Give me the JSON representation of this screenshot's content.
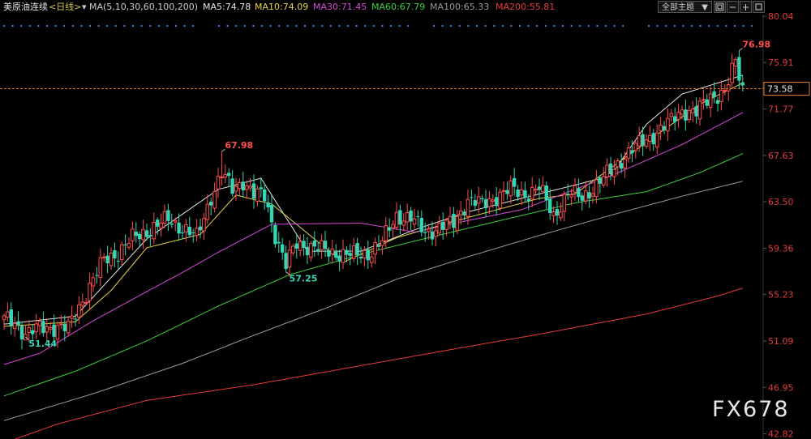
{
  "header": {
    "instrument": "美原油连续",
    "period": "<日线>",
    "ma_params": "MA(5,10,30,60,100,200)",
    "ma_values": [
      {
        "label": "MA5:74.78",
        "color": "#e6e6e6"
      },
      {
        "label": "MA10:74.09",
        "color": "#e8d44d"
      },
      {
        "label": "MA30:71.45",
        "color": "#d84ad8"
      },
      {
        "label": "MA60:67.79",
        "color": "#3ccf3c"
      },
      {
        "label": "MA100:65.33",
        "color": "#9a9a9a"
      },
      {
        "label": "MA200:55.81",
        "color": "#e83a3a"
      }
    ],
    "theme_select": "全部主题"
  },
  "colors": {
    "up": "#ff4d4d",
    "down": "#33d6b4",
    "axis_text": "#e03c3c",
    "last_price_line": "#e07b2b",
    "dots": "#2f7fff"
  },
  "watermark": "FX678",
  "chart_data": {
    "type": "candlestick",
    "y_range": [
      42.0,
      80.04
    ],
    "y_ticks": [
      "80.04",
      "75.91",
      "71.77",
      "67.63",
      "63.50",
      "59.36",
      "55.23",
      "51.09",
      "46.95",
      "42.82"
    ],
    "last_price": "73.58",
    "annotations": [
      {
        "label": "51.44",
        "value": 51.44,
        "index": 6,
        "kind": "low"
      },
      {
        "label": "67.98",
        "value": 67.98,
        "index": 61,
        "kind": "high"
      },
      {
        "label": "57.25",
        "value": 57.25,
        "index": 79,
        "kind": "low"
      },
      {
        "label": "76.98",
        "value": 76.98,
        "index": 206,
        "kind": "high"
      }
    ],
    "moving_averages": [
      {
        "name": "MA5",
        "color": "#e6e6e6",
        "values": [
          [
            0,
            52.6
          ],
          [
            20,
            53.3
          ],
          [
            40,
            60.2
          ],
          [
            60,
            64.6
          ],
          [
            72,
            65.6
          ],
          [
            85,
            59.1
          ],
          [
            100,
            59.1
          ],
          [
            115,
            61.0
          ],
          [
            130,
            62.6
          ],
          [
            150,
            64.2
          ],
          [
            170,
            65.8
          ],
          [
            180,
            70.4
          ],
          [
            190,
            73.1
          ],
          [
            207,
            74.78
          ]
        ]
      },
      {
        "name": "MA10",
        "color": "#e8d44d",
        "values": [
          [
            0,
            52.4
          ],
          [
            20,
            52.8
          ],
          [
            30,
            55.6
          ],
          [
            40,
            59.4
          ],
          [
            55,
            60.6
          ],
          [
            65,
            64.1
          ],
          [
            75,
            63.3
          ],
          [
            95,
            58.1
          ],
          [
            110,
            60.3
          ],
          [
            130,
            62.1
          ],
          [
            150,
            63.8
          ],
          [
            160,
            64.2
          ],
          [
            180,
            68.8
          ],
          [
            195,
            72.2
          ],
          [
            207,
            74.09
          ]
        ]
      },
      {
        "name": "MA30",
        "color": "#d84ad8",
        "values": [
          [
            0,
            49.0
          ],
          [
            10,
            50.0
          ],
          [
            25,
            52.9
          ],
          [
            40,
            55.5
          ],
          [
            50,
            57.2
          ],
          [
            60,
            59.0
          ],
          [
            75,
            61.5
          ],
          [
            100,
            61.6
          ],
          [
            115,
            60.8
          ],
          [
            125,
            61.5
          ],
          [
            145,
            62.8
          ],
          [
            170,
            65.8
          ],
          [
            190,
            68.6
          ],
          [
            207,
            71.45
          ]
        ]
      },
      {
        "name": "MA60",
        "color": "#3ccf3c",
        "values": [
          [
            0,
            46.2
          ],
          [
            20,
            48.4
          ],
          [
            40,
            51.1
          ],
          [
            60,
            54.2
          ],
          [
            80,
            57.0
          ],
          [
            100,
            58.8
          ],
          [
            115,
            60.0
          ],
          [
            140,
            61.9
          ],
          [
            160,
            63.4
          ],
          [
            180,
            64.4
          ],
          [
            195,
            66.1
          ],
          [
            207,
            67.79
          ]
        ]
      },
      {
        "name": "MA100",
        "color": "#9a9a9a",
        "values": [
          [
            0,
            44.0
          ],
          [
            25,
            46.4
          ],
          [
            50,
            49.1
          ],
          [
            70,
            51.6
          ],
          [
            90,
            54.0
          ],
          [
            110,
            56.6
          ],
          [
            130,
            58.6
          ],
          [
            150,
            60.5
          ],
          [
            170,
            62.3
          ],
          [
            190,
            64.0
          ],
          [
            207,
            65.33
          ]
        ]
      },
      {
        "name": "MA200",
        "color": "#e83a3a",
        "values": [
          [
            0,
            42.0
          ],
          [
            15,
            43.7
          ],
          [
            40,
            45.8
          ],
          [
            70,
            47.2
          ],
          [
            100,
            48.9
          ],
          [
            130,
            50.6
          ],
          [
            150,
            51.7
          ],
          [
            180,
            53.5
          ],
          [
            200,
            55.1
          ],
          [
            207,
            55.81
          ]
        ]
      }
    ],
    "price_path": [
      [
        0,
        53.0
      ],
      [
        3,
        52.7
      ],
      [
        6,
        51.8
      ],
      [
        10,
        52.2
      ],
      [
        15,
        52.4
      ],
      [
        18,
        52.2
      ],
      [
        20,
        53.5
      ],
      [
        24,
        56.0
      ],
      [
        28,
        58.3
      ],
      [
        32,
        59.0
      ],
      [
        36,
        60.2
      ],
      [
        40,
        60.9
      ],
      [
        43,
        61.4
      ],
      [
        46,
        61.9
      ],
      [
        50,
        61.2
      ],
      [
        54,
        60.3
      ],
      [
        58,
        64.0
      ],
      [
        61,
        66.0
      ],
      [
        64,
        64.6
      ],
      [
        67,
        65.4
      ],
      [
        70,
        64.1
      ],
      [
        73,
        64.0
      ],
      [
        76,
        60.6
      ],
      [
        79,
        57.8
      ],
      [
        82,
        59.8
      ],
      [
        86,
        59.5
      ],
      [
        90,
        59.1
      ],
      [
        94,
        58.9
      ],
      [
        98,
        58.7
      ],
      [
        102,
        58.9
      ],
      [
        106,
        59.9
      ],
      [
        110,
        62.3
      ],
      [
        114,
        62.0
      ],
      [
        118,
        60.8
      ],
      [
        122,
        61.2
      ],
      [
        126,
        61.6
      ],
      [
        130,
        63.7
      ],
      [
        134,
        63.2
      ],
      [
        138,
        64.0
      ],
      [
        142,
        64.6
      ],
      [
        146,
        64.2
      ],
      [
        150,
        64.7
      ],
      [
        154,
        62.3
      ],
      [
        158,
        64.2
      ],
      [
        162,
        63.9
      ],
      [
        166,
        65.0
      ],
      [
        170,
        66.2
      ],
      [
        174,
        67.6
      ],
      [
        178,
        68.6
      ],
      [
        182,
        69.5
      ],
      [
        186,
        70.4
      ],
      [
        190,
        71.7
      ],
      [
        194,
        71.4
      ],
      [
        198,
        72.9
      ],
      [
        202,
        73.3
      ],
      [
        205,
        75.9
      ],
      [
        207,
        73.58
      ]
    ]
  }
}
